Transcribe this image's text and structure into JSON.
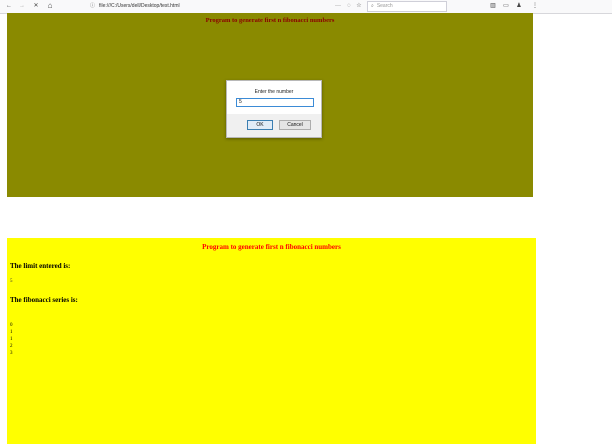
{
  "browser": {
    "back_glyph": "←",
    "forward_glyph": "→",
    "stop_glyph": "✕",
    "home_glyph": "⌂",
    "url": "file:///C:/Users/dell/Desktop/test.html",
    "info_glyph": "ⓘ",
    "more_glyph": "···",
    "pocket_glyph": "◌",
    "bookmark_glyph": "☆",
    "search_placeholder": "Search",
    "search_glyph": "⌕",
    "library_glyph": "▥",
    "sidebar_glyph": "▭",
    "account_glyph": "♟",
    "menu_glyph": "⋮"
  },
  "top_page": {
    "heading": "Program to generate first n fibonacci numbers",
    "background": "#8a8a00",
    "heading_color": "#8b0000",
    "dialog": {
      "message": "Enter the number",
      "input_value": "5",
      "ok_label": "OK",
      "cancel_label": "Cancel"
    }
  },
  "bottom_page": {
    "heading": "Program to generate first n fibonacci numbers",
    "background": "#ffff00",
    "heading_color": "#ff0000",
    "limit_label": "The limit entered is:",
    "limit_value": "5",
    "series_label": "The fibonacci series is:",
    "series": [
      "0",
      "1",
      "1",
      "2",
      "3"
    ]
  }
}
